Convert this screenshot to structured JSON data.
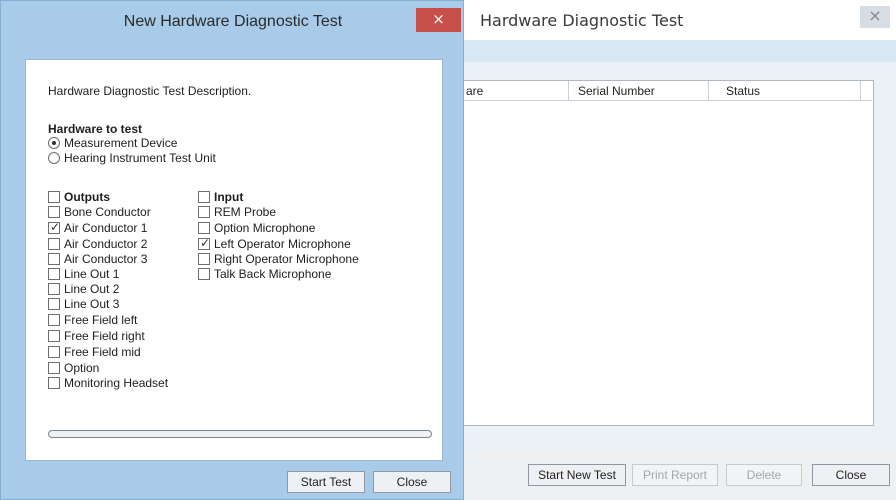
{
  "background_window": {
    "title": "Hardware Diagnostic Test",
    "close_glyph": "×",
    "table": {
      "columns": [
        "are",
        "Serial Number",
        "Status"
      ],
      "rows": []
    },
    "buttons": {
      "start_new_test": "Start New Test",
      "print_report": "Print Report",
      "delete": "Delete",
      "close": "Close"
    }
  },
  "dialog": {
    "title": "New Hardware Diagnostic Test",
    "close_glyph": "×",
    "description": "Hardware Diagnostic Test Description.",
    "hardware_to_test": {
      "label": "Hardware to test",
      "options": [
        {
          "label": "Measurement Device",
          "selected": true
        },
        {
          "label": "Hearing Instrument Test Unit",
          "selected": false
        }
      ]
    },
    "outputs": {
      "label": "Outputs",
      "checked": false,
      "items": [
        {
          "label": "Bone Conductor",
          "checked": false
        },
        {
          "label": "Air Conductor 1",
          "checked": true
        },
        {
          "label": "Air Conductor 2",
          "checked": false
        },
        {
          "label": "Air Conductor 3",
          "checked": false
        },
        {
          "label": "Line Out 1",
          "checked": false
        },
        {
          "label": "Line Out 2",
          "checked": false
        },
        {
          "label": "Line Out 3",
          "checked": false
        },
        {
          "label": "Free Field left",
          "checked": false
        },
        {
          "label": "Free Field right",
          "checked": false
        },
        {
          "label": "Free Field mid",
          "checked": false
        },
        {
          "label": "Option",
          "checked": false
        },
        {
          "label": "Monitoring Headset",
          "checked": false
        }
      ]
    },
    "input": {
      "label": "Input",
      "checked": false,
      "items": [
        {
          "label": "REM Probe",
          "checked": false
        },
        {
          "label": "Option Microphone",
          "checked": false
        },
        {
          "label": "Left Operator Microphone",
          "checked": true
        },
        {
          "label": "Right Operator Microphone",
          "checked": false
        },
        {
          "label": "Talk Back Microphone",
          "checked": false
        }
      ]
    },
    "progress_value": 0,
    "buttons": {
      "start_test": "Start Test",
      "close": "Close"
    }
  },
  "colors": {
    "dialog_frame": "#a8cbe9",
    "close_button": "#c7504b",
    "checkmark": "#303030"
  }
}
